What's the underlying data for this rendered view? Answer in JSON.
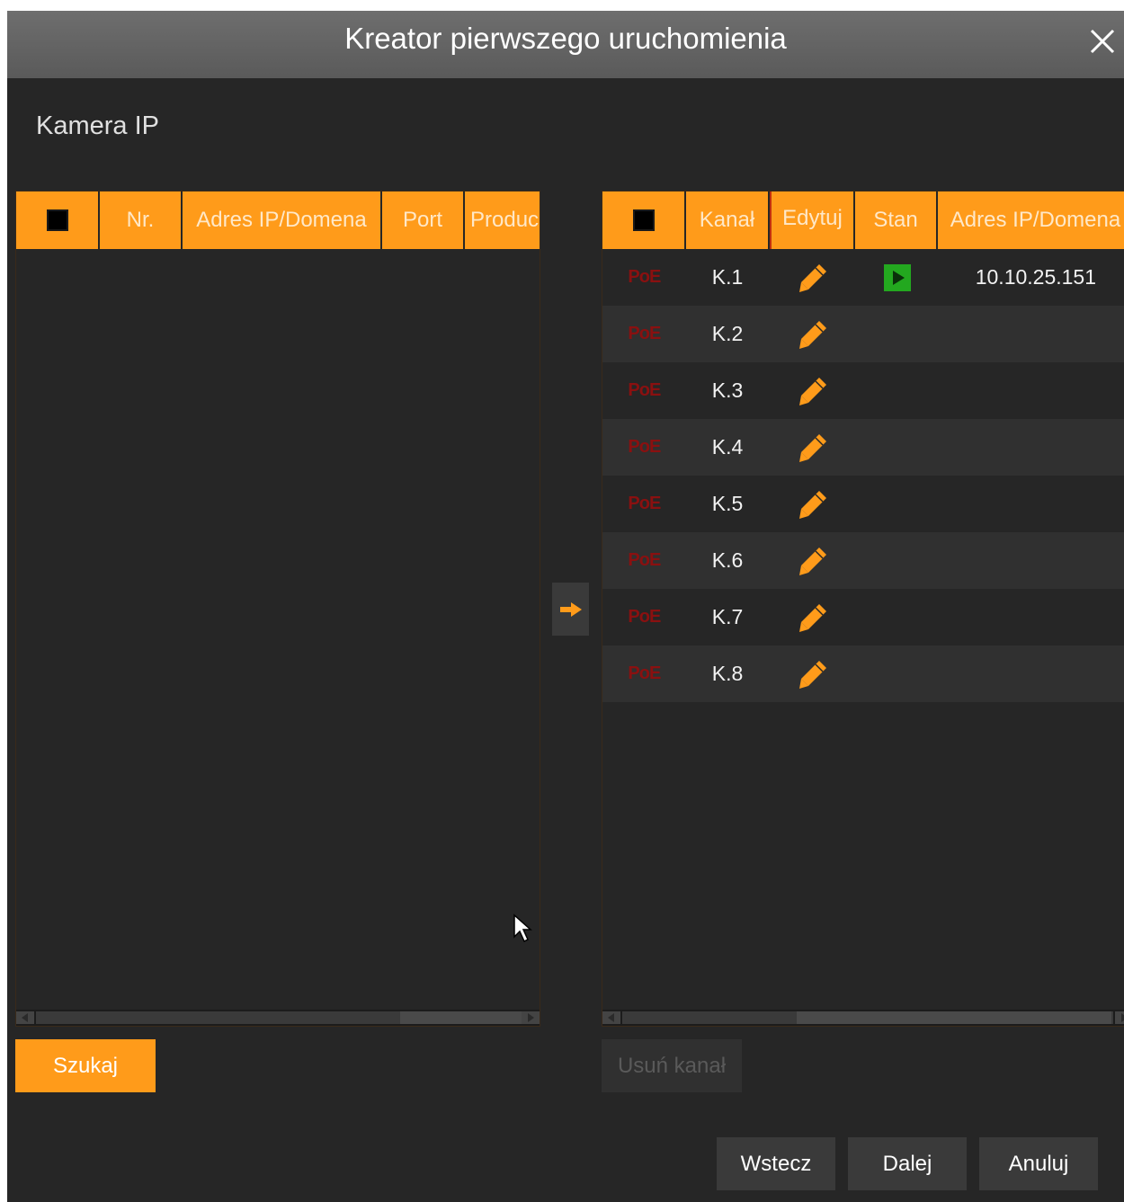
{
  "window": {
    "title": "Kreator pierwszego uruchomienia",
    "close_icon": "close-icon",
    "section_label": "Kamera IP"
  },
  "search_table": {
    "columns": [
      "",
      "Nr.",
      "Adres IP/Domena",
      "Port",
      "Produc"
    ],
    "rows": []
  },
  "channel_table": {
    "columns": [
      "",
      "Kanał",
      "Edytuj",
      "Stan",
      "Adres IP/Domena"
    ],
    "poe_label": "PoE",
    "rows": [
      {
        "channel": "K.1",
        "state": "play",
        "ip": "10.10.25.151"
      },
      {
        "channel": "K.2",
        "state": "",
        "ip": ""
      },
      {
        "channel": "K.3",
        "state": "",
        "ip": ""
      },
      {
        "channel": "K.4",
        "state": "",
        "ip": ""
      },
      {
        "channel": "K.5",
        "state": "",
        "ip": ""
      },
      {
        "channel": "K.6",
        "state": "",
        "ip": ""
      },
      {
        "channel": "K.7",
        "state": "",
        "ip": ""
      },
      {
        "channel": "K.8",
        "state": "",
        "ip": ""
      }
    ]
  },
  "buttons": {
    "search": "Szukaj",
    "delete_channel": "Usuń kanał",
    "back": "Wstecz",
    "next": "Dalej",
    "cancel": "Anuluj"
  },
  "colors": {
    "accent": "#ff9b1a",
    "background": "#262626",
    "titlebar": "#5f5f5f",
    "status_ok": "#23a81f",
    "poe": "#b3161a"
  }
}
